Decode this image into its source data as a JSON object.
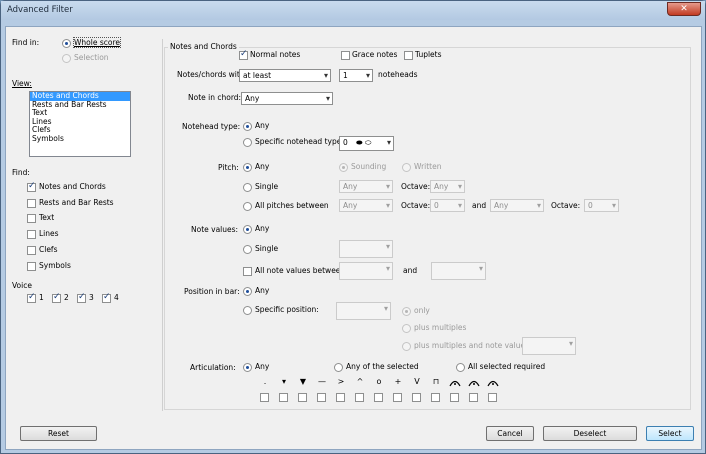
{
  "window": {
    "title": "Advanced Filter",
    "close_icon": "close-icon"
  },
  "find_in": {
    "label": "Find in:",
    "options": [
      "Whole score",
      "Selection"
    ],
    "selected": "Whole score"
  },
  "view": {
    "label": "View:",
    "items": [
      "Notes and Chords",
      "Rests and Bar Rests",
      "Text",
      "Lines",
      "Clefs",
      "Symbols"
    ],
    "selected": "Notes and Chords"
  },
  "find": {
    "label": "Find:",
    "items": [
      {
        "label": "Notes and Chords",
        "checked": true
      },
      {
        "label": "Rests and Bar Rests",
        "checked": false
      },
      {
        "label": "Text",
        "checked": false
      },
      {
        "label": "Lines",
        "checked": false
      },
      {
        "label": "Clefs",
        "checked": false
      },
      {
        "label": "Symbols",
        "checked": false
      }
    ]
  },
  "voice": {
    "label": "Voice",
    "items": [
      {
        "label": "1",
        "checked": true
      },
      {
        "label": "2",
        "checked": true
      },
      {
        "label": "3",
        "checked": true
      },
      {
        "label": "4",
        "checked": true
      }
    ]
  },
  "notes": {
    "group_title": "Notes and Chords",
    "normal_notes": "Normal notes",
    "grace_notes": "Grace notes",
    "tuplets": "Tuplets",
    "notes_with_label": "Notes/chords with",
    "notes_with_value": "at least",
    "notes_count": "1",
    "noteheads_label": "noteheads",
    "note_in_chord_label": "Note in chord:",
    "note_in_chord_value": "Any",
    "notehead_type_label": "Notehead type:",
    "notehead_any": "Any",
    "notehead_specific": "Specific notehead type",
    "notehead_value": "0",
    "pitch_label": "Pitch:",
    "pitch_any": "Any",
    "sounding": "Sounding",
    "written": "Written",
    "single": "Single",
    "single_value": "Any",
    "octave_label": "Octave:",
    "octave_value": "Any",
    "all_pitches": "All pitches between",
    "pitch_from": "Any",
    "octave_from": "0",
    "and_label": "and",
    "pitch_to": "Any",
    "octave_to": "0",
    "note_values_label": "Note values:",
    "nv_any": "Any",
    "nv_single": "Single",
    "nv_between": "All note values between",
    "nv_and": "and",
    "position_label": "Position in bar:",
    "pos_any": "Any",
    "pos_specific": "Specific position:",
    "only": "only",
    "plus_multiples": "plus multiples",
    "plus_multiples_nv": "plus multiples and note value:",
    "articulation_label": "Articulation:",
    "art_any": "Any",
    "art_any_selected": "Any of the selected",
    "art_all_selected": "All selected required",
    "articulation_symbols": [
      "staccato",
      "staccatissimo",
      "wedge",
      "tenuto",
      "accent",
      "marcato",
      "harmonic",
      "plus",
      "up-bow",
      "down-bow",
      "pause",
      "fermata",
      "long-fermata"
    ],
    "articulation_glyphs": [
      ".",
      "▾",
      "▼",
      "—",
      ">",
      "^",
      "o",
      "+",
      "V",
      "⊓",
      "",
      "",
      ""
    ]
  },
  "buttons": {
    "reset": "Reset",
    "cancel": "Cancel",
    "deselect": "Deselect",
    "select": "Select"
  }
}
